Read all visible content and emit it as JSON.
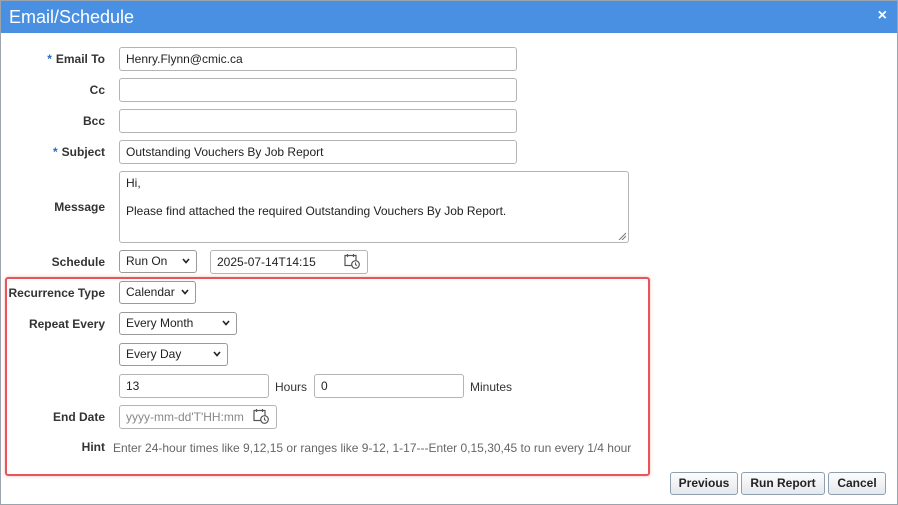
{
  "dialog": {
    "title": "Email/Schedule",
    "close_label": "×"
  },
  "form": {
    "email_to": {
      "label": "Email To",
      "required": "*",
      "value": "Henry.Flynn@cmic.ca"
    },
    "cc": {
      "label": "Cc",
      "value": ""
    },
    "bcc": {
      "label": "Bcc",
      "value": ""
    },
    "subject": {
      "label": "Subject",
      "required": "*",
      "value": "Outstanding Vouchers By Job Report"
    },
    "message": {
      "label": "Message",
      "value": "Hi,\n\nPlease find attached the required Outstanding Vouchers By Job Report."
    },
    "schedule": {
      "label": "Schedule",
      "selected": "Run On",
      "datetime": "2025-07-14T14:15"
    },
    "recurrence_type": {
      "label": "Recurrence Type",
      "selected": "Calendar"
    },
    "repeat_every": {
      "label": "Repeat Every",
      "month_selected": "Every Month",
      "day_selected": "Every Day"
    },
    "time": {
      "hours_value": "13",
      "hours_label": "Hours",
      "minutes_value": "0",
      "minutes_label": "Minutes"
    },
    "end_date": {
      "label": "End Date",
      "placeholder": "yyyy-mm-dd'T'HH:mm"
    },
    "hint": {
      "label": "Hint",
      "text": "Enter 24-hour times like 9,12,15 or ranges like 9-12, 1-17---Enter 0,15,30,45 to run every 1/4 hour"
    }
  },
  "buttons": {
    "previous": "Previous",
    "run_report": "Run Report",
    "cancel": "Cancel"
  },
  "colors": {
    "titlebar": "#4a90e2",
    "highlight": "#e9545a",
    "required": "#2a6ac8"
  }
}
